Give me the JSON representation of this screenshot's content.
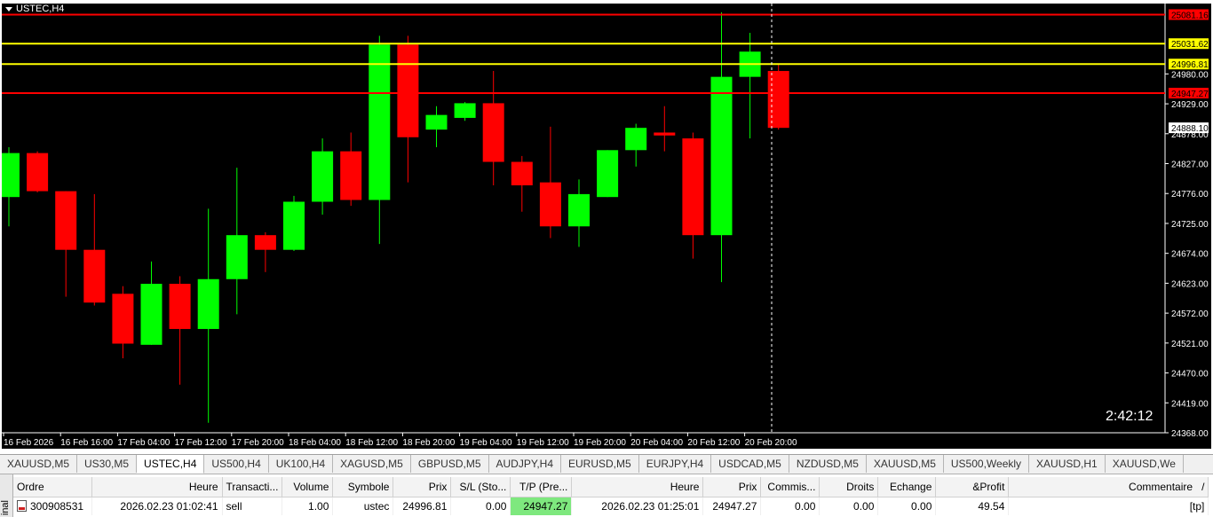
{
  "chart": {
    "symbol_label": "USTEC,H4",
    "countdown": "2:42:12",
    "colors": {
      "background": "#000000",
      "bull": "#00ff00",
      "bear": "#ff0000",
      "axis": "#ffffff",
      "hline_red": "#ff0000",
      "hline_yellow": "#ffff00"
    },
    "price_ticks": [
      "24980.00",
      "24929.00",
      "24878.00",
      "24827.00",
      "24776.00",
      "24725.00",
      "24674.00",
      "24623.00",
      "24572.00",
      "24521.00",
      "24470.00",
      "24419.00",
      "24368.00"
    ],
    "time_labels": [
      "16 Feb 2026",
      "16 Feb 16:00",
      "17 Feb 04:00",
      "17 Feb 12:00",
      "17 Feb 20:00",
      "18 Feb 04:00",
      "18 Feb 12:00",
      "18 Feb 20:00",
      "19 Feb 04:00",
      "19 Feb 12:00",
      "19 Feb 20:00",
      "20 Feb 04:00",
      "20 Feb 12:00",
      "20 Feb 20:00"
    ],
    "price_tags": [
      {
        "price": 25081.16,
        "label": "25081.16",
        "color": "#ff0000",
        "text_color": "#000000"
      },
      {
        "price": 25031.62,
        "label": "25031.62",
        "color": "#ffff00",
        "text_color": "#000000"
      },
      {
        "price": 24996.81,
        "label": "24996.81",
        "color": "#ffff00",
        "text_color": "#000000"
      },
      {
        "price": 24947.27,
        "label": "24947.27",
        "color": "#ff0000",
        "text_color": "#000000"
      },
      {
        "price": 24888.1,
        "label": "24888.10",
        "color": "#ffffff",
        "text_color": "#000000"
      }
    ]
  },
  "chart_data": {
    "type": "candlestick",
    "ylim": [
      24368,
      25100
    ],
    "candles": [
      {
        "o": 24770,
        "h": 24855,
        "l": 24720,
        "c": 24845
      },
      {
        "o": 24845,
        "h": 24848,
        "l": 24778,
        "c": 24780
      },
      {
        "o": 24780,
        "h": 24780,
        "l": 24600,
        "c": 24680
      },
      {
        "o": 24680,
        "h": 24775,
        "l": 24585,
        "c": 24590
      },
      {
        "o": 24605,
        "h": 24618,
        "l": 24495,
        "c": 24520
      },
      {
        "o": 24518,
        "h": 24660,
        "l": 24518,
        "c": 24622
      },
      {
        "o": 24622,
        "h": 24635,
        "l": 24450,
        "c": 24545
      },
      {
        "o": 24545,
        "h": 24750,
        "l": 24385,
        "c": 24630
      },
      {
        "o": 24630,
        "h": 24820,
        "l": 24570,
        "c": 24705
      },
      {
        "o": 24705,
        "h": 24710,
        "l": 24642,
        "c": 24680
      },
      {
        "o": 24680,
        "h": 24772,
        "l": 24678,
        "c": 24762
      },
      {
        "o": 24762,
        "h": 24870,
        "l": 24740,
        "c": 24848
      },
      {
        "o": 24848,
        "h": 24880,
        "l": 24755,
        "c": 24765
      },
      {
        "o": 24765,
        "h": 25045,
        "l": 24690,
        "c": 25030
      },
      {
        "o": 25030,
        "h": 25045,
        "l": 24795,
        "c": 24872
      },
      {
        "o": 24885,
        "h": 24925,
        "l": 24855,
        "c": 24910
      },
      {
        "o": 24905,
        "h": 24932,
        "l": 24900,
        "c": 24930
      },
      {
        "o": 24930,
        "h": 24985,
        "l": 24790,
        "c": 24830
      },
      {
        "o": 24830,
        "h": 24840,
        "l": 24745,
        "c": 24790
      },
      {
        "o": 24795,
        "h": 24890,
        "l": 24700,
        "c": 24720
      },
      {
        "o": 24720,
        "h": 24800,
        "l": 24685,
        "c": 24775
      },
      {
        "o": 24770,
        "h": 24850,
        "l": 24770,
        "c": 24850
      },
      {
        "o": 24850,
        "h": 24895,
        "l": 24822,
        "c": 24888
      },
      {
        "o": 24880,
        "h": 24925,
        "l": 24848,
        "c": 24875
      },
      {
        "o": 24870,
        "h": 24880,
        "l": 24665,
        "c": 24705
      },
      {
        "o": 24705,
        "h": 25085,
        "l": 24625,
        "c": 24975
      },
      {
        "o": 24975,
        "h": 25050,
        "l": 24870,
        "c": 25018
      },
      {
        "o": 24985,
        "h": 24998,
        "l": 24885,
        "c": 24888
      }
    ]
  },
  "tabs": [
    "XAUUSD,M5",
    "US30,M5",
    "USTEC,H4",
    "US500,H4",
    "UK100,H4",
    "XAGUSD,M5",
    "GBPUSD,M5",
    "AUDJPY,H4",
    "EURUSD,M5",
    "EURJPY,H4",
    "USDCAD,M5",
    "NZDUSD,M5",
    "XAUUSD,M5",
    "US500,Weekly",
    "XAUUSD,H1",
    "XAUUSD,We"
  ],
  "active_tab": 2,
  "terminal": {
    "side_label": "inal",
    "columns": [
      "Ordre",
      "Heure",
      "Transacti...",
      "Volume",
      "Symbole",
      "Prix",
      "S/L (Sto...",
      "T/P (Pre...",
      "Heure",
      "Prix",
      "Commis...",
      "Droits",
      "Echange",
      "&Profit",
      "Commentaire"
    ],
    "sort_indicator": "/",
    "rows": [
      [
        "300908531",
        "2026.02.23 01:02:41",
        "sell",
        "1.00",
        "ustec",
        "24996.81",
        "0.00",
        "24947.27",
        "2026.02.23 01:25:01",
        "24947.27",
        "0.00",
        "0.00",
        "0.00",
        "49.54",
        "[tp]"
      ]
    ]
  }
}
